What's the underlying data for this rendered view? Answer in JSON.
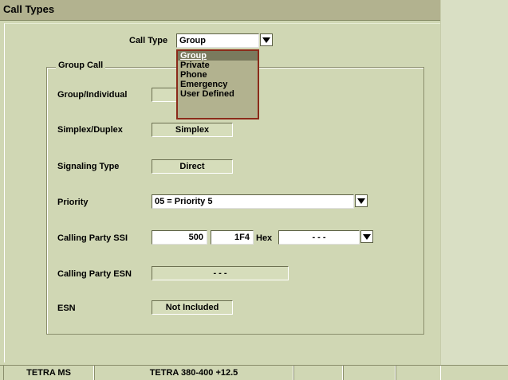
{
  "window": {
    "title": "Call Types"
  },
  "call_type": {
    "label": "Call Type",
    "value": "Group"
  },
  "dropdown": {
    "options": [
      "Group",
      "Private",
      "Phone",
      "Emergency",
      "User Defined"
    ],
    "selected": "Group"
  },
  "group_call": {
    "title": "Group Call",
    "group_individual": {
      "label": "Group/Individual",
      "value": ""
    },
    "simplex_duplex": {
      "label": "Simplex/Duplex",
      "value": "Simplex"
    },
    "signaling_type": {
      "label": "Signaling Type",
      "value": "Direct"
    },
    "priority": {
      "label": "Priority",
      "value": "05 = Priority 5"
    },
    "calling_party_ssi": {
      "label": "Calling Party SSI",
      "decimal": "500",
      "hex": "1F4",
      "hex_label": "Hex",
      "extra": "- - -"
    },
    "calling_party_esn": {
      "label": "Calling Party ESN",
      "value": "- - -"
    },
    "esn": {
      "label": "ESN",
      "value": "Not Included"
    }
  },
  "status_bar": {
    "mode": "TETRA MS",
    "band": "TETRA 380-400 +12.5"
  },
  "colors": {
    "background": "#d0d7b4",
    "title_bar": "#b2b28f",
    "popup_border": "#8b2a1a"
  }
}
